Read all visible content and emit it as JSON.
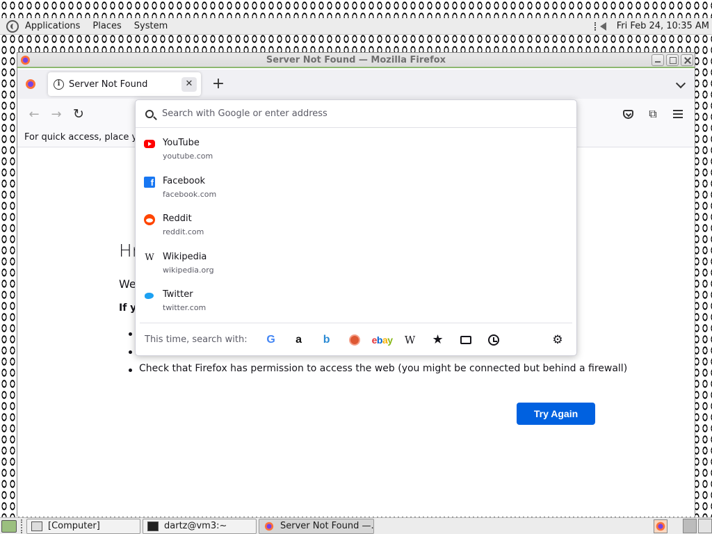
{
  "top_panel": {
    "menus": [
      "Applications",
      "Places",
      "System"
    ],
    "clock": "Fri Feb 24, 10:35 AM"
  },
  "window": {
    "title": "Server Not Found — Mozilla Firefox"
  },
  "tab": {
    "title": "Server Not Found",
    "close_glyph": "✕",
    "new_tab_glyph": "+"
  },
  "nav": {
    "back_glyph": "←",
    "forward_glyph": "→",
    "reload_glyph": "↻",
    "extensions_glyph": "⧉"
  },
  "bookmarks_bar": {
    "text": "For quick access, place your"
  },
  "error_page": {
    "title": "Hm",
    "description": "We",
    "hint": "If yo",
    "bullets": [
      "",
      "",
      "Check that Firefox has permission to access the web (you might be connected but behind a firewall)"
    ],
    "try_again_label": "Try Again"
  },
  "urlbar": {
    "placeholder": "Search with Google or enter address",
    "top_sites": [
      {
        "name": "YouTube",
        "url": "youtube.com",
        "icon": "youtube-icon"
      },
      {
        "name": "Facebook",
        "url": "facebook.com",
        "icon": "facebook-icon"
      },
      {
        "name": "Reddit",
        "url": "reddit.com",
        "icon": "reddit-icon"
      },
      {
        "name": "Wikipedia",
        "url": "wikipedia.org",
        "icon": "wikipedia-icon"
      },
      {
        "name": "Twitter",
        "url": "twitter.com",
        "icon": "twitter-icon"
      }
    ],
    "oneoff_label": "This time, search with:",
    "oneoff_engines": [
      "google-icon",
      "amazon-icon",
      "bing-icon",
      "duckduckgo-icon",
      "ebay-icon",
      "wikipedia-icon",
      "bookmarks-star-icon",
      "tabs-icon",
      "history-icon",
      "gear-icon"
    ],
    "oneoff_glyphs": {
      "google": "G",
      "amazon": "a",
      "bing": "b",
      "ebay": "ebay",
      "wikipedia": "W",
      "star": "★",
      "gear": "⚙"
    },
    "favicon_glyphs": {
      "facebook": "f",
      "wikipedia": "W"
    }
  },
  "taskbar": {
    "tasks": [
      {
        "label": "[Computer]"
      },
      {
        "label": "dartz@vm3:~"
      },
      {
        "label": "Server Not Found —..."
      }
    ]
  },
  "colors": {
    "accent": "#0061e0",
    "titlebar_border": "#8cb86f"
  }
}
